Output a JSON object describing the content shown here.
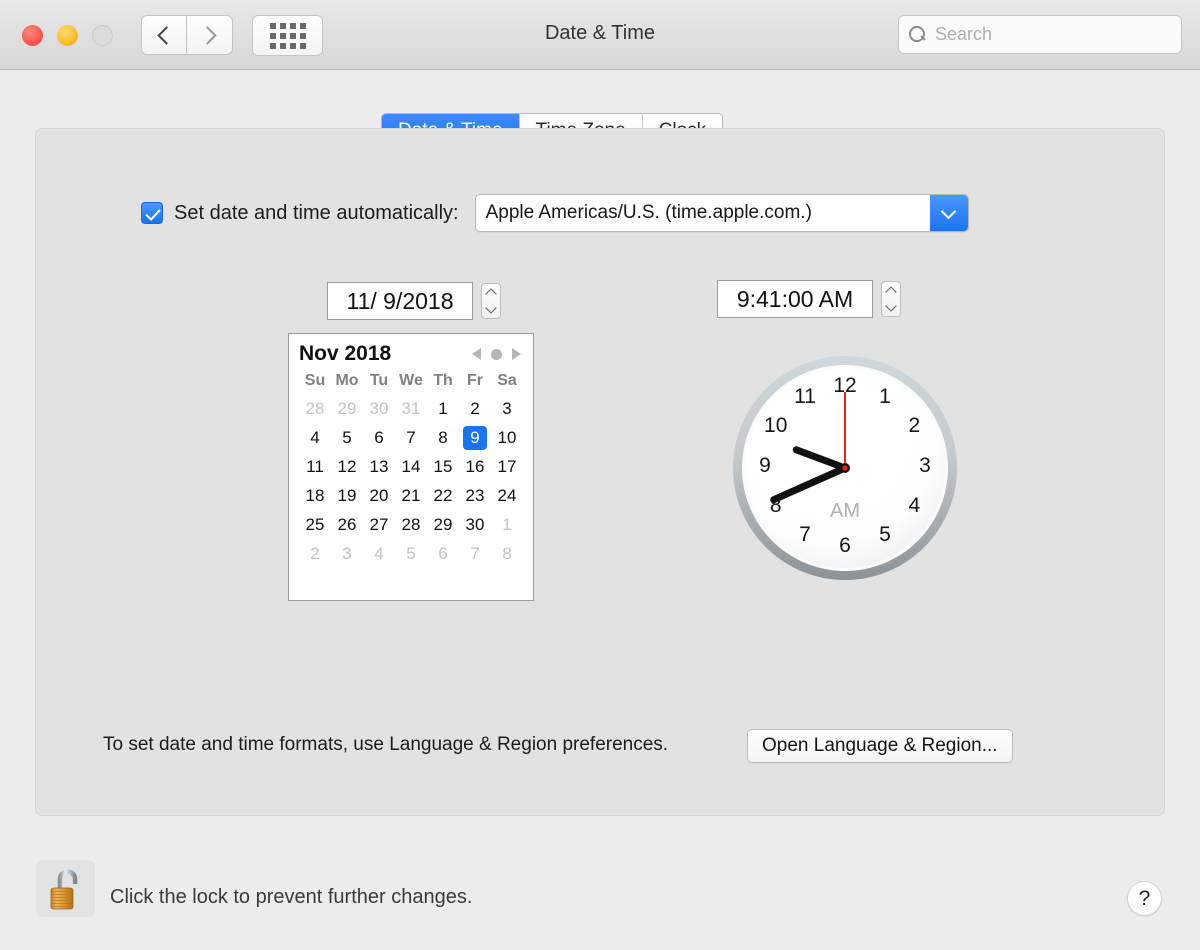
{
  "window": {
    "title": "Date & Time",
    "traffic_lights": [
      "close",
      "minimize",
      "zoom"
    ],
    "nav_back_icon": "chevron-left-icon",
    "nav_forward_icon": "chevron-right-icon",
    "grid_icon": "show-all-grid-icon"
  },
  "search": {
    "placeholder": "Search",
    "value": "",
    "icon": "search-icon"
  },
  "tabs": [
    {
      "label": "Date & Time",
      "active": true
    },
    {
      "label": "Time Zone",
      "active": false
    },
    {
      "label": "Clock",
      "active": false
    }
  ],
  "auto_row": {
    "checked": true,
    "label": "Set date and time automatically:",
    "server_value": "Apple Americas/U.S. (time.apple.com.)",
    "dropdown_icon": "chevron-down-icon"
  },
  "date_field": {
    "value": "11/  9/2018",
    "stepper_up_icon": "stepper-up-icon",
    "stepper_down_icon": "stepper-down-icon"
  },
  "time_field": {
    "value": "9:41:00 AM",
    "stepper_up_icon": "stepper-up-icon",
    "stepper_down_icon": "stepper-down-icon"
  },
  "calendar": {
    "title": "Nov 2018",
    "prev_icon": "triangle-left-icon",
    "today_icon": "circle-dot-icon",
    "next_icon": "triangle-right-icon",
    "weekdays": [
      "Su",
      "Mo",
      "Tu",
      "We",
      "Th",
      "Fr",
      "Sa"
    ],
    "selected_day": 9,
    "weeks": [
      [
        {
          "d": "28",
          "muted": true
        },
        {
          "d": "29",
          "muted": true
        },
        {
          "d": "30",
          "muted": true
        },
        {
          "d": "31",
          "muted": true
        },
        {
          "d": "1",
          "muted": false
        },
        {
          "d": "2",
          "muted": false
        },
        {
          "d": "3",
          "muted": false
        }
      ],
      [
        {
          "d": "4",
          "muted": false
        },
        {
          "d": "5",
          "muted": false
        },
        {
          "d": "6",
          "muted": false
        },
        {
          "d": "7",
          "muted": false
        },
        {
          "d": "8",
          "muted": false
        },
        {
          "d": "9",
          "muted": false,
          "selected": true
        },
        {
          "d": "10",
          "muted": false
        }
      ],
      [
        {
          "d": "11",
          "muted": false
        },
        {
          "d": "12",
          "muted": false
        },
        {
          "d": "13",
          "muted": false
        },
        {
          "d": "14",
          "muted": false
        },
        {
          "d": "15",
          "muted": false
        },
        {
          "d": "16",
          "muted": false
        },
        {
          "d": "17",
          "muted": false
        }
      ],
      [
        {
          "d": "18",
          "muted": false
        },
        {
          "d": "19",
          "muted": false
        },
        {
          "d": "20",
          "muted": false
        },
        {
          "d": "21",
          "muted": false
        },
        {
          "d": "22",
          "muted": false
        },
        {
          "d": "23",
          "muted": false
        },
        {
          "d": "24",
          "muted": false
        }
      ],
      [
        {
          "d": "25",
          "muted": false
        },
        {
          "d": "26",
          "muted": false
        },
        {
          "d": "27",
          "muted": false
        },
        {
          "d": "28",
          "muted": false
        },
        {
          "d": "29",
          "muted": false
        },
        {
          "d": "30",
          "muted": false
        },
        {
          "d": "1",
          "muted": true
        }
      ],
      [
        {
          "d": "2",
          "muted": true
        },
        {
          "d": "3",
          "muted": true
        },
        {
          "d": "4",
          "muted": true
        },
        {
          "d": "5",
          "muted": true
        },
        {
          "d": "6",
          "muted": true
        },
        {
          "d": "7",
          "muted": true
        },
        {
          "d": "8",
          "muted": true
        }
      ]
    ]
  },
  "clock": {
    "numerals": [
      "12",
      "1",
      "2",
      "3",
      "4",
      "5",
      "6",
      "7",
      "8",
      "9",
      "10",
      "11"
    ],
    "ampm": "AM",
    "hour": 9,
    "minute": 41,
    "second": 0,
    "second_hand_color": "#ee2211"
  },
  "footer": {
    "note": "To set date and time formats, use Language & Region preferences.",
    "button_label": "Open Language & Region..."
  },
  "bottom_bar": {
    "lock_icon": "unlocked-padlock-icon",
    "lock_text": "Click the lock to prevent further changes.",
    "help_label": "?"
  },
  "colors": {
    "accent_blue": "#1a73f0",
    "window_bg": "#ececec",
    "panel_bg": "#e2e2e2",
    "selected_day_bg": "#1a73f0"
  }
}
